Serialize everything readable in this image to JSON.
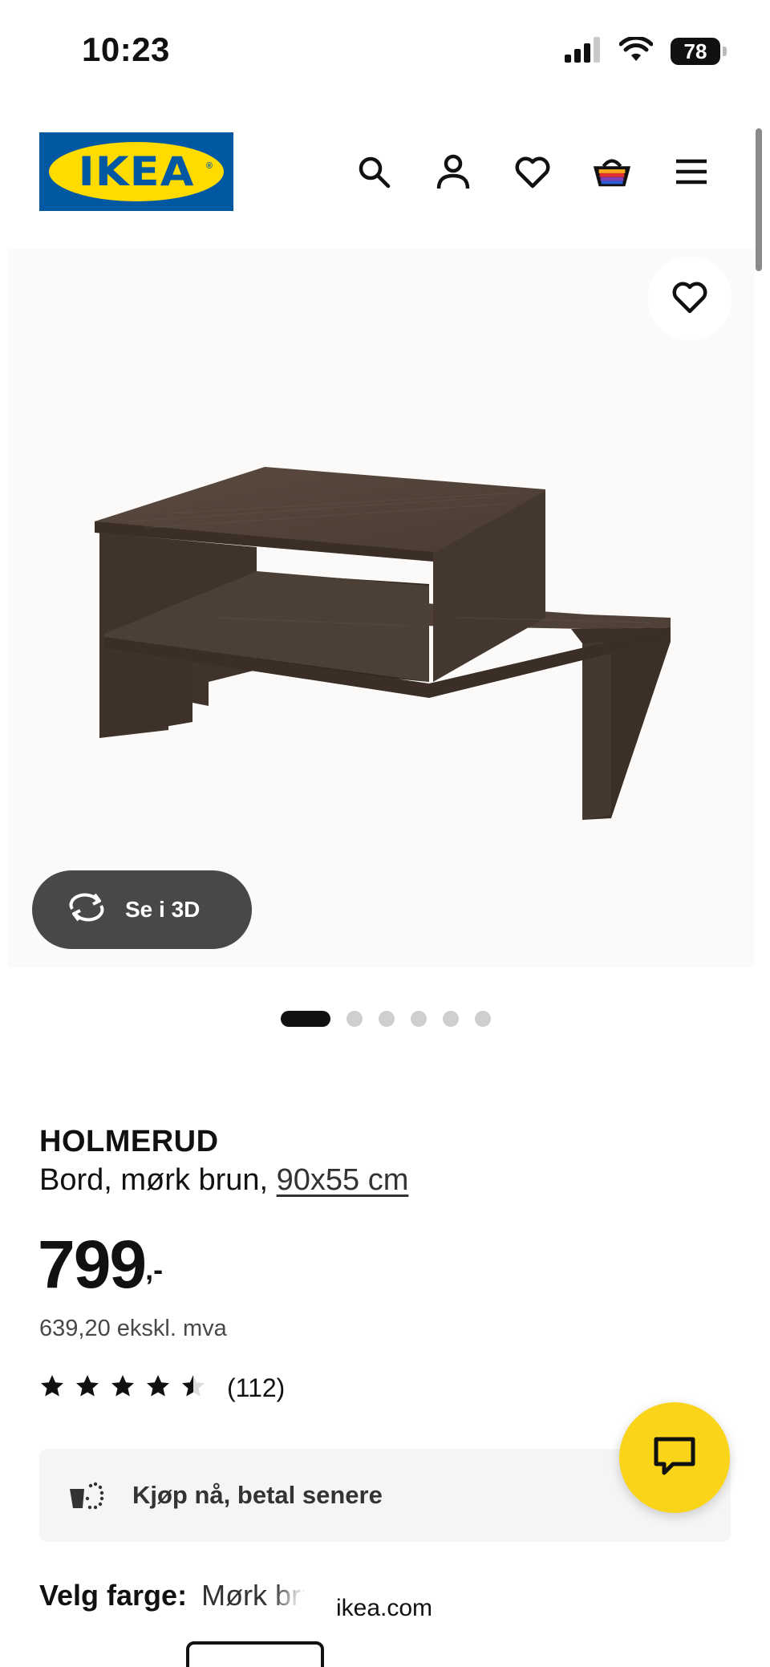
{
  "status_bar": {
    "time": "10:23",
    "battery": "78"
  },
  "header": {
    "logo_text": "IKEA",
    "icons": [
      "search-icon",
      "account-icon",
      "favourites-icon",
      "cart-icon",
      "menu-icon"
    ]
  },
  "gallery": {
    "view_3d_label": "Se i 3D",
    "image_count": 6,
    "active_index": 0
  },
  "product": {
    "name": "HOLMERUD",
    "description": "Bord, mørk brun,",
    "size": "90x55 cm",
    "price": "799",
    "price_suffix": ",-",
    "price_ex_vat": "639,20 ekskl. mva",
    "rating": 4.5,
    "rating_max": 5,
    "review_count": "(112)"
  },
  "klarna": {
    "label": "Kjøp nå, betal senere"
  },
  "color_select": {
    "label": "Velg farge:",
    "value": "Mørk brun"
  },
  "browser": {
    "url": "ikea.com"
  },
  "colors": {
    "ikea_blue": "#0058a3",
    "ikea_yellow": "#ffdb00",
    "chat_yellow": "#fad419",
    "wood": "#4a3c33"
  }
}
